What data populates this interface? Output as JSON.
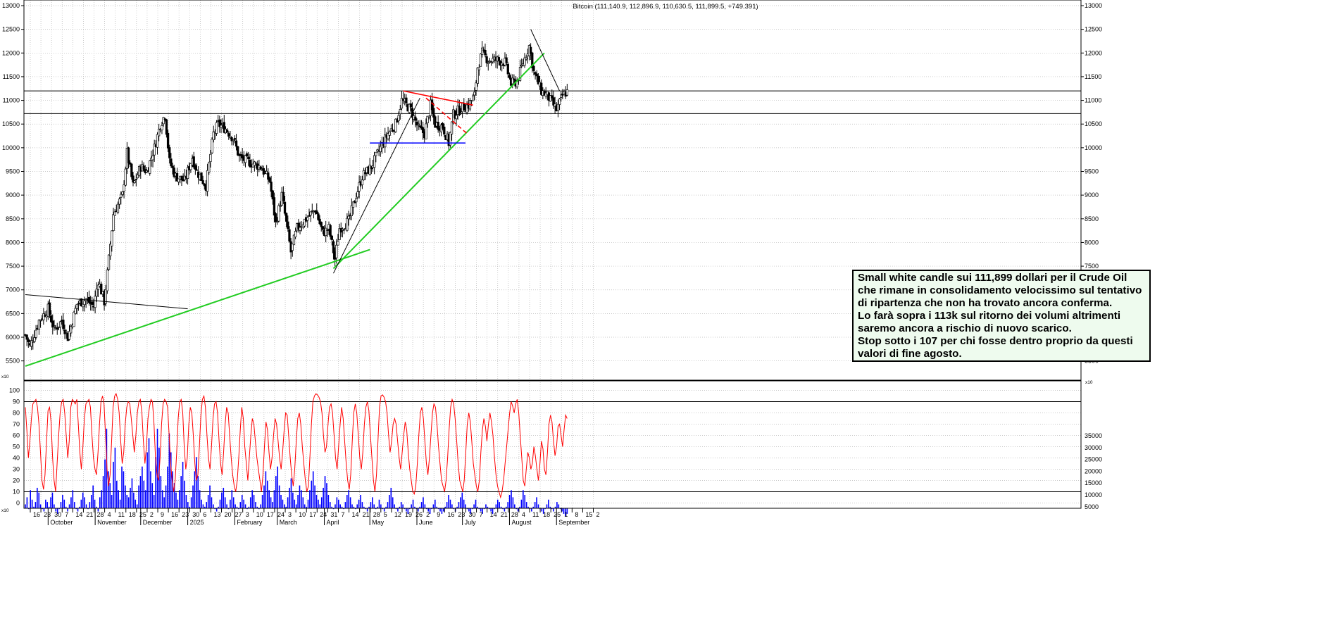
{
  "chart_data": [
    {
      "type": "candlestick",
      "title": "Bitcoin (111,140.9, 112,896.9, 110,630.5, 111,899.5, +749.391)",
      "y_axis_unit_marker": "x10",
      "ylim": [
        5200,
        13000
      ],
      "yticks": [
        "13000",
        "12500",
        "12000",
        "11500",
        "11000",
        "10500",
        "10000",
        "9500",
        "9000",
        "8500",
        "8000",
        "7500",
        "7000",
        "6500",
        "6000",
        "5500"
      ],
      "x_day_ticks": [
        "16",
        "23",
        "30",
        "7",
        "14",
        "21",
        "28",
        "4",
        "11",
        "18",
        "25",
        "2",
        "9",
        "16",
        "23",
        "30",
        "6",
        "13",
        "20",
        "27",
        "3",
        "10",
        "17",
        "24",
        "3",
        "10",
        "17",
        "24",
        "31",
        "7",
        "14",
        "21",
        "28",
        "5",
        "12",
        "19",
        "26",
        "2",
        "9",
        "16",
        "23",
        "30",
        "7",
        "14",
        "21",
        "28",
        "4",
        "11",
        "18",
        "25",
        "1",
        "8",
        "15",
        "2"
      ],
      "x_month_labels": [
        "October",
        "November",
        "December",
        "2025",
        "February",
        "March",
        "April",
        "May",
        "June",
        "July",
        "August",
        "September"
      ],
      "price_series": {
        "name": "Bitcoin",
        "last_close": 111899.5,
        "anchors": [
          [
            "2024-09-16",
            6050
          ],
          [
            "2024-09-19",
            5800
          ],
          [
            "2024-09-25",
            6350
          ],
          [
            "2024-10-01",
            6600
          ],
          [
            "2024-10-05",
            6150
          ],
          [
            "2024-10-10",
            6350
          ],
          [
            "2024-10-14",
            6000
          ],
          [
            "2024-10-20",
            6700
          ],
          [
            "2024-10-26",
            6800
          ],
          [
            "2024-10-31",
            6650
          ],
          [
            "2024-11-03",
            7200
          ],
          [
            "2024-11-07",
            6750
          ],
          [
            "2024-11-10",
            7650
          ],
          [
            "2024-11-13",
            8600
          ],
          [
            "2024-11-19",
            9000
          ],
          [
            "2024-11-22",
            9900
          ],
          [
            "2024-11-26",
            9200
          ],
          [
            "2024-12-01",
            9600
          ],
          [
            "2024-12-05",
            9500
          ],
          [
            "2024-12-10",
            10000
          ],
          [
            "2024-12-14",
            10500
          ],
          [
            "2024-12-17",
            10700
          ],
          [
            "2024-12-20",
            9700
          ],
          [
            "2024-12-24",
            9400
          ],
          [
            "2024-12-30",
            9300
          ],
          [
            "2025-01-04",
            9800
          ],
          [
            "2025-01-07",
            9500
          ],
          [
            "2025-01-13",
            9200
          ],
          [
            "2025-01-18",
            10300
          ],
          [
            "2025-01-21",
            10500
          ],
          [
            "2025-01-26",
            10400
          ],
          [
            "2025-01-31",
            10200
          ],
          [
            "2025-02-04",
            9800
          ],
          [
            "2025-02-10",
            9700
          ],
          [
            "2025-02-18",
            9600
          ],
          [
            "2025-02-24",
            9300
          ],
          [
            "2025-02-28",
            8400
          ],
          [
            "2025-03-04",
            9000
          ],
          [
            "2025-03-10",
            7800
          ],
          [
            "2025-03-14",
            8300
          ],
          [
            "2025-03-20",
            8500
          ],
          [
            "2025-03-26",
            8700
          ],
          [
            "2025-03-31",
            8200
          ],
          [
            "2025-04-04",
            8300
          ],
          [
            "2025-04-08",
            7650
          ],
          [
            "2025-04-11",
            8300
          ],
          [
            "2025-04-17",
            8450
          ],
          [
            "2025-04-22",
            9000
          ],
          [
            "2025-04-26",
            9400
          ],
          [
            "2025-05-02",
            9600
          ],
          [
            "2025-05-08",
            10000
          ],
          [
            "2025-05-13",
            10300
          ],
          [
            "2025-05-18",
            10500
          ],
          [
            "2025-05-22",
            11000
          ],
          [
            "2025-05-28",
            10800
          ],
          [
            "2025-06-02",
            10400
          ],
          [
            "2025-06-06",
            10300
          ],
          [
            "2025-06-10",
            10900
          ],
          [
            "2025-06-13",
            10500
          ],
          [
            "2025-06-18",
            10450
          ],
          [
            "2025-06-22",
            10100
          ],
          [
            "2025-06-25",
            10700
          ],
          [
            "2025-07-01",
            10850
          ],
          [
            "2025-07-05",
            10900
          ],
          [
            "2025-07-09",
            11100
          ],
          [
            "2025-07-11",
            11700
          ],
          [
            "2025-07-14",
            12000
          ],
          [
            "2025-07-18",
            11850
          ],
          [
            "2025-07-24",
            11850
          ],
          [
            "2025-07-29",
            11800
          ],
          [
            "2025-08-02",
            11350
          ],
          [
            "2025-08-06",
            11400
          ],
          [
            "2025-08-10",
            11800
          ],
          [
            "2025-08-14",
            12150
          ],
          [
            "2025-08-17",
            11600
          ],
          [
            "2025-08-22",
            11200
          ],
          [
            "2025-08-26",
            11100
          ],
          [
            "2025-09-01",
            10800
          ],
          [
            "2025-09-05",
            11100
          ],
          [
            "2025-09-08",
            11190
          ]
        ]
      },
      "horizontal_levels": [
        {
          "value": 11200,
          "color": "#000000"
        },
        {
          "value": 10720,
          "color": "#000000"
        }
      ],
      "trendlines": [
        {
          "color": "#22cc22",
          "from": [
            "2024-09-16",
            5390
          ],
          "to": [
            "2025-05-01",
            7850
          ]
        },
        {
          "color": "#22cc22",
          "from": [
            "2025-04-07",
            7450
          ],
          "to": [
            "2025-08-24",
            12000
          ]
        },
        {
          "color": "#000000",
          "from": [
            "2024-09-16",
            6900
          ],
          "to": [
            "2025-01-01",
            6600
          ]
        },
        {
          "color": "#000000",
          "from": [
            "2025-04-07",
            7350
          ],
          "to": [
            "2025-06-03",
            11050
          ]
        },
        {
          "color": "#000000",
          "from": [
            "2025-08-15",
            12500
          ],
          "to": [
            "2025-09-03",
            11200
          ]
        },
        {
          "color": "#ff0000",
          "from": [
            "2025-05-23",
            11200
          ],
          "to": [
            "2025-07-08",
            10900
          ]
        },
        {
          "color": "#ff0000",
          "dashed": true,
          "from": [
            "2025-06-07",
            11050
          ],
          "to": [
            "2025-07-04",
            10300
          ]
        },
        {
          "color": "#0000ff",
          "from": [
            "2025-05-01",
            10100
          ],
          "to": [
            "2025-07-03",
            10100
          ]
        }
      ]
    },
    {
      "type": "line",
      "name": "oscillator",
      "ylim": [
        0,
        100
      ],
      "yticks": [
        "100",
        "90",
        "80",
        "70",
        "60",
        "50",
        "40",
        "30",
        "20",
        "10",
        "0"
      ],
      "y_axis_unit_marker": "x10",
      "reference_levels": [
        90,
        10
      ],
      "series_color": "#ff0000",
      "values": [
        85,
        65,
        40,
        55,
        75,
        88,
        90,
        92,
        85,
        70,
        45,
        20,
        12,
        25,
        55,
        82,
        85,
        72,
        40,
        20,
        10,
        35,
        60,
        80,
        90,
        92,
        80,
        60,
        40,
        55,
        85,
        92,
        90,
        88,
        92,
        70,
        45,
        30,
        50,
        75,
        88,
        90,
        92,
        85,
        60,
        40,
        30,
        25,
        45,
        70,
        90,
        95,
        88,
        60,
        30,
        15,
        25,
        55,
        85,
        95,
        97,
        92,
        80,
        55,
        35,
        45,
        70,
        85,
        90,
        88,
        75,
        60,
        45,
        60,
        80,
        90,
        92,
        80,
        55,
        35,
        50,
        75,
        85,
        92,
        90,
        70,
        40,
        25,
        20,
        40,
        70,
        88,
        92,
        90,
        85,
        60,
        35,
        20,
        10,
        20,
        45,
        75,
        90,
        92,
        80,
        50,
        30,
        40,
        70,
        85,
        80,
        60,
        35,
        20,
        25,
        50,
        78,
        92,
        95,
        85,
        60,
        40,
        30,
        50,
        75,
        88,
        90,
        80,
        55,
        35,
        25,
        45,
        70,
        85,
        80,
        60,
        40,
        25,
        15,
        10,
        20,
        40,
        65,
        85,
        75,
        50,
        35,
        20,
        40,
        60,
        75,
        70,
        55,
        40,
        30,
        20,
        10,
        25,
        50,
        72,
        65,
        45,
        30,
        40,
        60,
        75,
        70,
        55,
        40,
        30,
        45,
        65,
        80,
        78,
        60,
        40,
        25,
        15,
        30,
        55,
        75,
        80,
        70,
        50,
        35,
        20,
        10,
        15,
        40,
        70,
        90,
        95,
        97,
        96,
        94,
        90,
        80,
        60,
        45,
        50,
        70,
        85,
        88,
        80,
        60,
        40,
        30,
        50,
        70,
        85,
        75,
        55,
        35,
        20,
        12,
        25,
        55,
        80,
        88,
        80,
        60,
        40,
        30,
        45,
        70,
        85,
        90,
        82,
        60,
        40,
        20,
        10,
        25,
        55,
        85,
        95,
        96,
        94,
        90,
        80,
        60,
        45,
        55,
        70,
        75,
        70,
        55,
        40,
        30,
        45,
        60,
        72,
        65,
        45,
        30,
        20,
        10,
        8,
        15,
        35,
        60,
        80,
        85,
        75,
        55,
        35,
        25,
        40,
        60,
        80,
        88,
        85,
        70,
        50,
        35,
        20,
        15,
        10,
        20,
        40,
        65,
        85,
        92,
        88,
        75,
        55,
        35,
        20,
        15,
        10,
        20,
        45,
        70,
        80,
        72,
        55,
        35,
        25,
        15,
        10,
        20,
        45,
        65,
        75,
        68,
        55,
        70,
        80,
        72,
        60,
        40,
        25,
        15,
        10,
        5,
        10,
        20,
        35,
        50,
        65,
        80,
        90,
        86,
        80,
        88,
        92,
        80,
        60,
        40,
        20,
        15,
        30,
        45,
        40,
        30,
        35,
        50,
        42,
        30,
        20,
        35,
        55,
        48,
        30,
        25,
        45,
        70,
        78,
        72,
        55,
        42,
        50,
        68,
        70,
        60,
        50,
        65,
        78,
        75
      ]
    },
    {
      "type": "bar",
      "name": "volume",
      "y_axis_unit_marker": "x10",
      "ylim": [
        0,
        37500
      ],
      "yticks": [
        "35000",
        "30000",
        "25000",
        "20000",
        "15000",
        "10000",
        "5000"
      ],
      "series_color": "#0000ff",
      "values": [
        6000,
        9000,
        4000,
        12000,
        8000,
        5000,
        7000,
        13000,
        11000,
        6000,
        4000,
        3000,
        8000,
        7000,
        5000,
        9000,
        11000,
        6000,
        3000,
        2000,
        4000,
        7000,
        10000,
        8000,
        5000,
        3000,
        6000,
        9000,
        12000,
        7000,
        4000,
        3000,
        5000,
        8000,
        11000,
        9000,
        6000,
        4000,
        7000,
        10000,
        14000,
        8000,
        5000,
        3000,
        9000,
        12000,
        18000,
        25000,
        38000,
        20000,
        15000,
        10000,
        24000,
        30000,
        16000,
        12000,
        8000,
        22000,
        20000,
        14000,
        10000,
        9000,
        13000,
        17000,
        11000,
        8000,
        6000,
        14000,
        18000,
        22000,
        16000,
        12000,
        28000,
        34000,
        20000,
        15000,
        10000,
        26000,
        38000,
        30000,
        18000,
        12000,
        9000,
        14000,
        22000,
        36000,
        28000,
        20000,
        15000,
        11000,
        8000,
        12000,
        18000,
        24000,
        16000,
        10000,
        7000,
        5000,
        9000,
        14000,
        20000,
        26000,
        18000,
        12000,
        8000,
        6000,
        5000,
        7000,
        10000,
        14000,
        9000,
        6000,
        4000,
        3000,
        5000,
        8000,
        11000,
        13000,
        9000,
        6000,
        4000,
        8000,
        12000,
        9000,
        6000,
        5000,
        4000,
        7000,
        10000,
        8000,
        6000,
        4000,
        5000,
        9000,
        12000,
        10000,
        7000,
        5000,
        4000,
        6000,
        10000,
        14000,
        20000,
        16000,
        12000,
        9000,
        7000,
        12000,
        18000,
        22000,
        14000,
        10000,
        8000,
        6000,
        5000,
        9000,
        13000,
        17000,
        11000,
        8000,
        6000,
        10000,
        14000,
        12000,
        9000,
        6000,
        5000,
        8000,
        12000,
        16000,
        20000,
        14000,
        10000,
        8000,
        6000,
        9000,
        13000,
        18000,
        15000,
        10000,
        7000,
        5000,
        4000,
        6000,
        9000,
        8000,
        6000,
        5000,
        4000,
        7000,
        10000,
        12000,
        9000,
        6000,
        5000,
        4000,
        6000,
        8000,
        10000,
        7000,
        5000,
        4000,
        3000,
        5000,
        7000,
        9000,
        6000,
        4000,
        5000,
        8000,
        6000,
        4000,
        3000,
        5000,
        7000,
        10000,
        13000,
        9000,
        6000,
        4000,
        3000,
        5000,
        7000,
        6000,
        4000,
        3000,
        2000,
        4000,
        6000,
        8000,
        5000,
        4000,
        3000,
        5000,
        7000,
        9000,
        6000,
        4000,
        3000,
        2000,
        4000,
        6000,
        8000,
        5000,
        4000,
        3000,
        2000,
        3000,
        5000,
        7000,
        10000,
        8000,
        6000,
        4000,
        3000,
        5000,
        7000,
        9000,
        11000,
        8000,
        6000,
        4000,
        3000,
        2000,
        4000,
        6000,
        8000,
        5000,
        4000,
        3000,
        2000,
        4000,
        6000,
        5000,
        4000,
        3000,
        2000,
        4000,
        6000,
        8000,
        7000,
        5000,
        4000,
        3000,
        5000,
        7000,
        10000,
        12000,
        9000,
        6000,
        4000,
        3000,
        5000,
        8000,
        12000,
        10000,
        7000,
        5000,
        4000,
        3000,
        5000,
        7000,
        9000,
        6000,
        4000,
        3000,
        2000,
        4000,
        6000,
        8000,
        5000,
        4000,
        3000,
        5000,
        7000,
        6000,
        4000,
        3000,
        2000,
        1000,
        2000
      ]
    }
  ],
  "annotation": {
    "lines": [
      "Small white candle sui 111,899 dollari per il Crude Oil",
      "che rimane in consolidamento velocissimo sul tentativo",
      "di ripartenza che non ha trovato ancora conferma.",
      "Lo farà sopra i 113k sul ritorno dei volumi altrimenti",
      "saremo ancora a rischio di nuovo scarico.",
      "Stop sotto i 107 per chi fosse dentro proprio da questi",
      "valori di fine agosto."
    ],
    "background": "#eefbee"
  },
  "colors": {
    "grid": "#b8b8b8",
    "axis": "#000000",
    "candle_up": "#ffffff",
    "candle_down": "#000000"
  }
}
